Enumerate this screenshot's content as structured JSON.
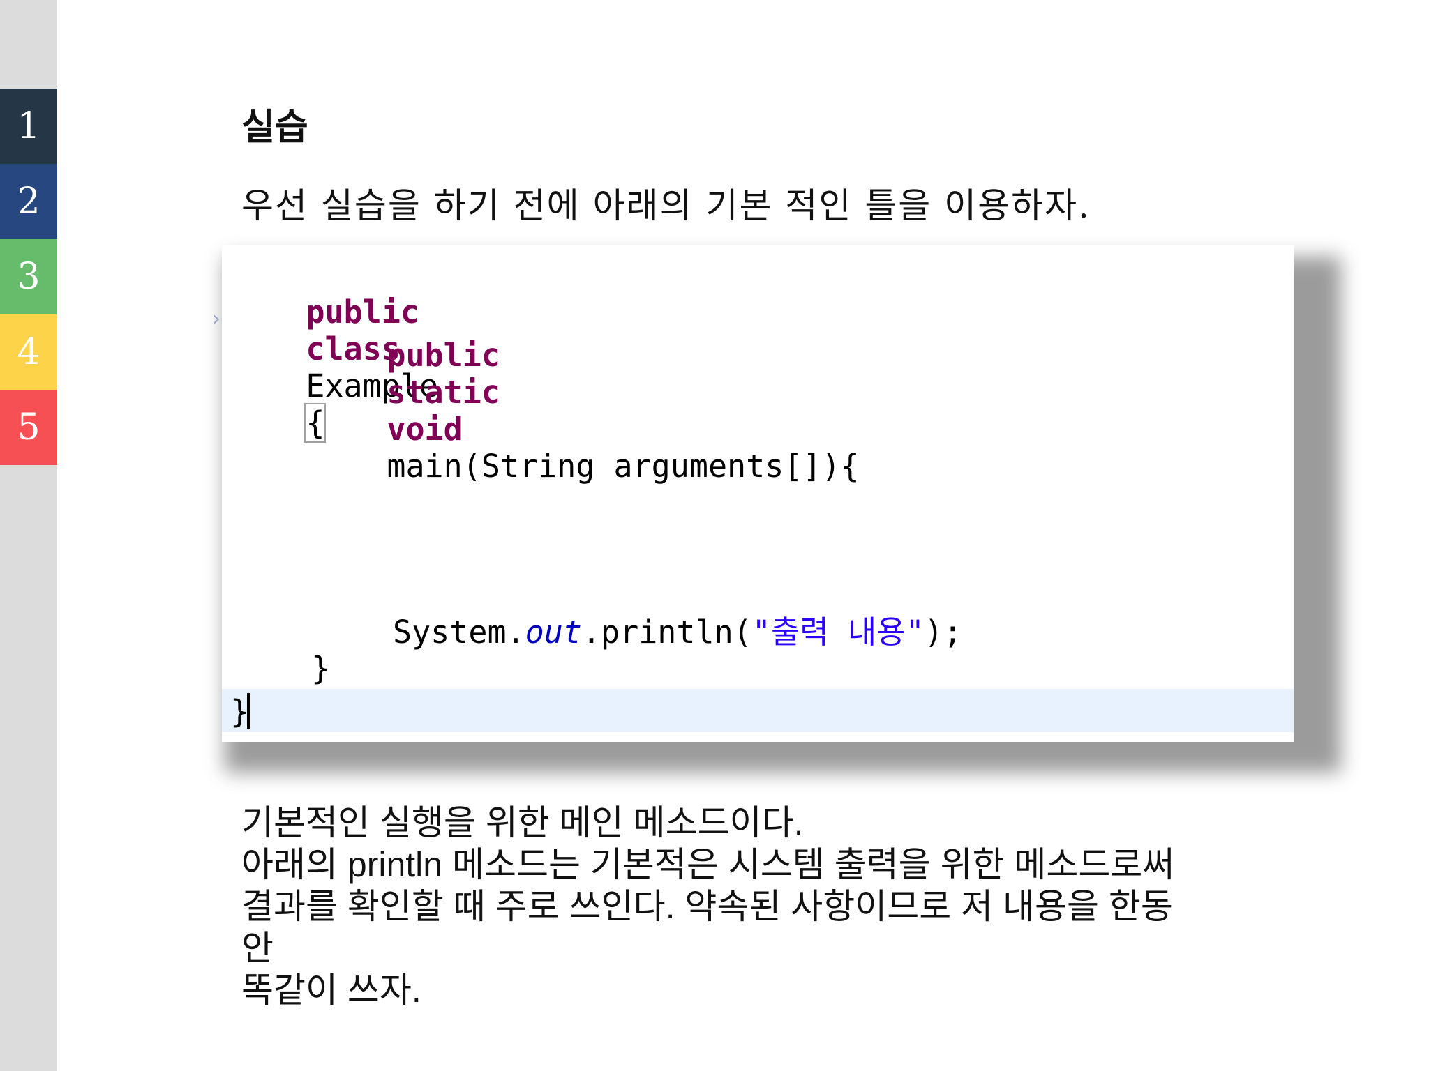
{
  "sidebar": {
    "tabs": [
      {
        "label": "1",
        "color": "#253746"
      },
      {
        "label": "2",
        "color": "#26477f"
      },
      {
        "label": "3",
        "color": "#67bc6b"
      },
      {
        "label": "4",
        "color": "#fdd34a"
      },
      {
        "label": "5",
        "color": "#f65054"
      }
    ]
  },
  "slide": {
    "title": "실습",
    "intro": "우선 실습을 하기 전에 아래의 기본 적인 틀을 이용하자."
  },
  "code": {
    "l1_kw1": "public",
    "l1_kw2": "class",
    "l1_name": "Example",
    "l1_brace": "{",
    "l2_kw1": "public",
    "l2_kw2": "static",
    "l2_kw3": "void",
    "l2_rest": "main(String arguments[]){",
    "l3_a": "System.",
    "l3_out": "out",
    "l3_b": ".println(",
    "l3_str": "\"출력 내용\"",
    "l3_c": ");",
    "l4": "}",
    "l5": "}"
  },
  "description": {
    "lines": [
      "기본적인 실행을 위한 메인 메소드이다.",
      "아래의 println 메소드는 기본적은 시스템 출력을 위한 메소드로써",
      "결과를 확인할 때 주로 쓰인다. 약속된 사항이므로 저 내용을 한동",
      "안",
      "똑같이 쓰자."
    ]
  }
}
